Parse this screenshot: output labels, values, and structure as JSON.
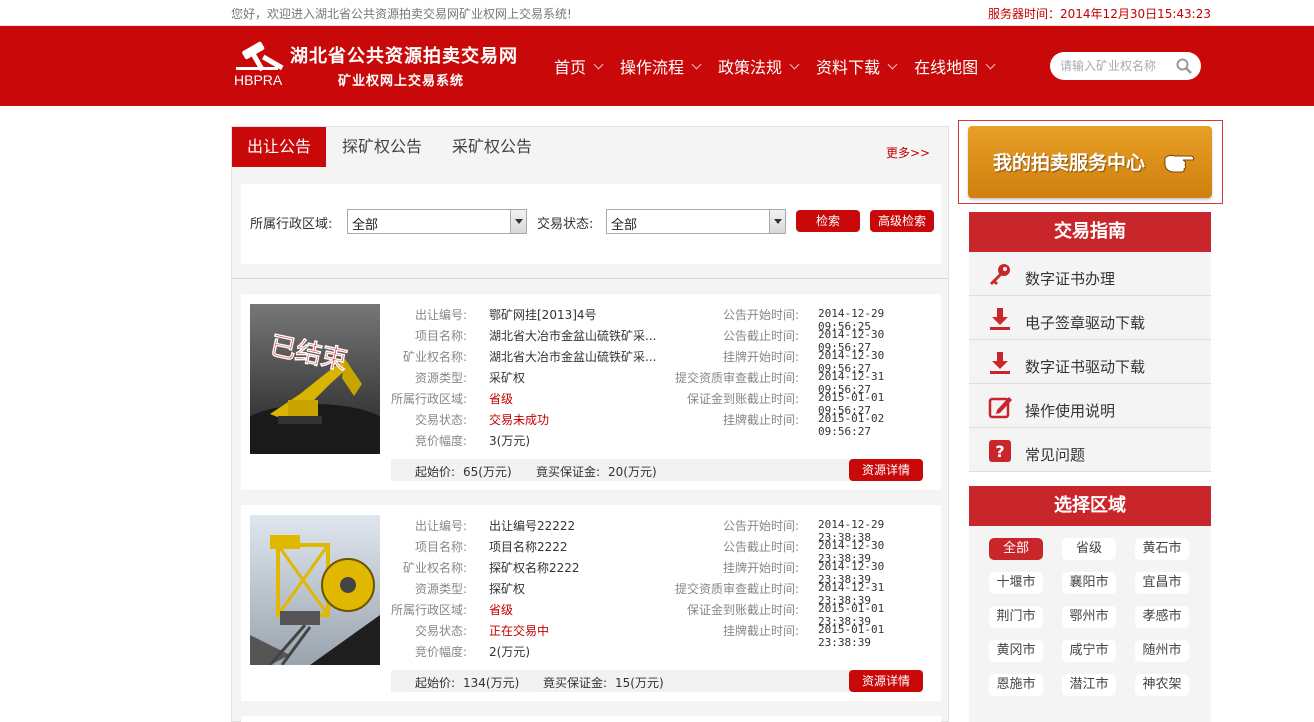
{
  "topbar": {
    "welcome": "您好，欢迎进入湖北省公共资源拍卖交易网矿业权网上交易系统!",
    "server_time_label": "服务器时间：",
    "server_time": "2014年12月30日15:43:23"
  },
  "header": {
    "site_title": "湖北省公共资源拍卖交易网",
    "site_subtitle": "矿业权网上交易系统",
    "abbr": "HBPRA",
    "nav": [
      "首页",
      "操作流程",
      "政策法规",
      "资料下载",
      "在线地图"
    ],
    "search_placeholder": "请输入矿业权名称"
  },
  "tabs": [
    "出让公告",
    "探矿权公告",
    "采矿权公告"
  ],
  "more_label": "更多>>",
  "filter": {
    "region_label": "所属行政区域:",
    "region_value": "全部",
    "status_label": "交易状态:",
    "status_value": "全部",
    "search_button": "检索",
    "advanced_button": "高级检索"
  },
  "labels": {
    "code": "出让编号:",
    "project": "项目名称:",
    "right": "矿业权名称:",
    "type": "资源类型:",
    "region": "所属行政区域:",
    "status": "交易状态:",
    "increment": "竞价幅度:",
    "notice_start": "公告开始时间:",
    "notice_end": "公告截止时间:",
    "list_start": "挂牌开始时间:",
    "review_end": "提交资质审查截止时间:",
    "deposit_end": "保证金到账截止时间:",
    "list_end": "挂牌截止时间:",
    "start_price": "起始价:",
    "deposit": "竟买保证金:",
    "detail_button": "资源详情"
  },
  "listings": [
    {
      "code": "鄂矿网挂[2013]4号",
      "project": "湖北省大冶市金盆山硫铁矿采...",
      "right": "湖北省大冶市金盆山硫铁矿采...",
      "type": "采矿权",
      "region": "省级",
      "status": "交易未成功",
      "increment": "3(万元)",
      "notice_start": "2014-12-29 09:56:25",
      "notice_end": "2014-12-30 09:56:27",
      "list_start": "2014-12-30 09:56:27",
      "review_end": "2014-12-31 09:56:27",
      "deposit_end": "2015-01-01 09:56:27",
      "list_end": "2015-01-02 09:56:27",
      "start_price": "65(万元)",
      "deposit": "20(万元)",
      "stamp": "已结束",
      "deposit_label": "竟买保证金:"
    },
    {
      "code": "出让编号22222",
      "project": "项目名称2222",
      "right": "探矿权名称2222",
      "type": "探矿权",
      "region": "省级",
      "status": "正在交易中",
      "increment": "2(万元)",
      "notice_start": "2014-12-29 23:38:38",
      "notice_end": "2014-12-30 23:38:39",
      "list_start": "2014-12-30 23:38:39",
      "review_end": "2014-12-31 23:38:39",
      "deposit_end": "2015-01-01 23:38:39",
      "list_end": "2015-01-01 23:38:39",
      "start_price": "134(万元)",
      "deposit": "15(万元)",
      "deposit_label": "竟买保证金:"
    }
  ],
  "service_center": "我的拍卖服务中心",
  "guide": {
    "title": "交易指南",
    "items": [
      "数字证书办理",
      "电子签章驱动下载",
      "数字证书驱动下载",
      "操作使用说明",
      "常见问题"
    ]
  },
  "regions": {
    "title": "选择区域",
    "items": [
      "全部",
      "省级",
      "黄石市",
      "十堰市",
      "襄阳市",
      "宜昌市",
      "荆门市",
      "鄂州市",
      "孝感市",
      "黄冈市",
      "咸宁市",
      "随州市",
      "恩施市",
      "潜江市",
      "神农架"
    ]
  },
  "colors": {
    "brand_red": "#c90909",
    "orange": "#e8a026"
  }
}
